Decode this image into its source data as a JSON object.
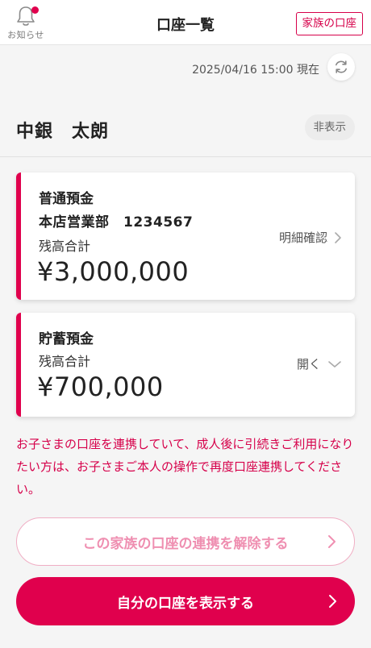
{
  "header": {
    "notice_label": "お知らせ",
    "title": "口座一覧",
    "family_button": "家族の口座"
  },
  "updated": {
    "text": "2025/04/16 15:00 現在"
  },
  "user": {
    "name": "中銀　太朗",
    "hide_button": "非表示"
  },
  "accounts": [
    {
      "type": "普通預金",
      "branch": "本店営業部　1234567",
      "balance_label": "残高合計",
      "balance": "¥3,000,000",
      "action": "明細確認"
    },
    {
      "type": "貯蓄預金",
      "balance_label": "残高合計",
      "balance": "¥700,000",
      "action": "開く"
    }
  ],
  "notice": "お子さまの口座を連携していて、成人後に引続きご利用になりたい方は、お子さまご本人の操作で再度口座連携してください。",
  "buttons": {
    "unlink": "この家族の口座の連携を解除する",
    "show_own": "自分の口座を表示する"
  },
  "colors": {
    "accent": "#e0004d",
    "accent_light": "#f0aec4"
  }
}
